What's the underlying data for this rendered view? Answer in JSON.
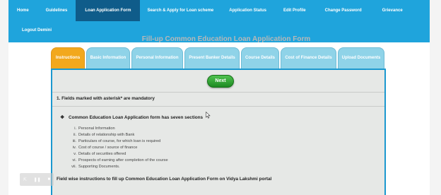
{
  "nav": {
    "row1": [
      {
        "label": "Home",
        "active": false
      },
      {
        "label": "Guidelines",
        "active": false
      },
      {
        "label": "Loan Application Form",
        "active": true
      },
      {
        "label": "Search & Apply for Loan scheme",
        "active": false
      },
      {
        "label": "Application Status",
        "active": false
      },
      {
        "label": "Edit Profile",
        "active": false
      },
      {
        "label": "Change Password",
        "active": false
      },
      {
        "label": "Grievance",
        "active": false
      }
    ],
    "row2": [
      {
        "label": "Logout Demini"
      }
    ]
  },
  "page_title": "Fill-up Common Education Loan Application Form",
  "tabs": [
    {
      "label": "Instructions",
      "active": true
    },
    {
      "label": "Basic Information",
      "active": false
    },
    {
      "label": "Personal Information",
      "active": false
    },
    {
      "label": "Present Banker Details",
      "active": false
    },
    {
      "label": "Course Details",
      "active": false
    },
    {
      "label": "Cost of Finance Details",
      "active": false
    },
    {
      "label": "Upload Documents",
      "active": false
    }
  ],
  "panel": {
    "next_label": "Next",
    "mandatory_note": "1. Fields marked with asterisk* are mandatory",
    "sections_heading": "Common Education Loan Application form has seven sections",
    "sections": [
      {
        "num": "i.",
        "text": "Personal Information"
      },
      {
        "num": "ii.",
        "text": "Details of relationship with Bank"
      },
      {
        "num": "iii.",
        "text": "Particulars of course, for which loan is required"
      },
      {
        "num": "iv.",
        "text": "Cost of course / source of finance"
      },
      {
        "num": "v.",
        "text": "Details of securities offered"
      },
      {
        "num": "vi.",
        "text": "Prospects of earning after completion of the course"
      },
      {
        "num": "vii.",
        "text": "Supporting Documents."
      }
    ],
    "fieldwise_heading": "Field wise instructions to fill up Common Education Loan Application Form on Vidya Lakshmi portal"
  },
  "colors": {
    "navbar": "#1fa4dc",
    "nav_active": "#0f5c8a",
    "tab": "#8fd3e8",
    "tab_active": "#f2a81d",
    "panel": "#e6e8e6",
    "next_button": "#2a9e2f"
  }
}
